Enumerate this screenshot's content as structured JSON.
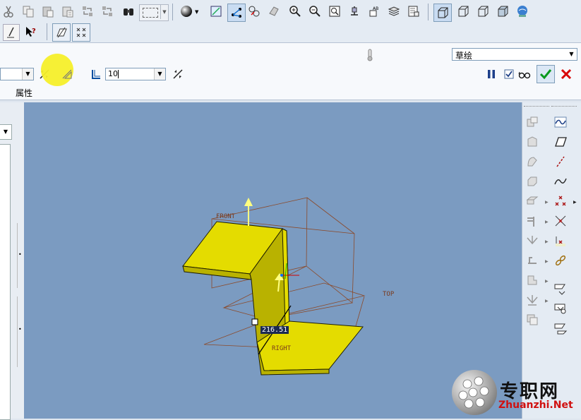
{
  "toolbar": {
    "row1_icons": [
      "cut-icon",
      "copy-icon",
      "paste-icon",
      "paste-special-icon",
      "regenerate-icon",
      "regenerate-manager-icon",
      "find-icon",
      "select-box-icon",
      "shading-icon",
      "repaint-icon",
      "sketch-orient-icon",
      "datum-display-icon",
      "zoom-in-icon",
      "zoom-out-icon",
      "refit-icon",
      "spin-center-icon",
      "named-views-icon",
      "layers-icon",
      "model-tree-icon",
      "wireframe-icon",
      "hidden-line-icon",
      "no-hidden-icon",
      "shaded-icon",
      "help-web-icon"
    ],
    "row2_icons": [
      "sketch-tool-icon",
      "context-help-icon",
      "plane-tool-icon",
      "axis-tool-icon"
    ]
  },
  "dashboard": {
    "thickness_value": "10",
    "tab_label": "属性",
    "mode_select": "草绘"
  },
  "viewport": {
    "datum_labels": [
      "FRONT",
      "TOP",
      "RIGHT"
    ],
    "dimension": "216.51",
    "background": "#7b9bc1",
    "sheet_color": "#e4dc00"
  },
  "watermark": {
    "cn_text": "专职网",
    "url_text": "Zhuanzhi.Net"
  },
  "side_tools": [
    "sketch-icon",
    "parallelogram-icon",
    "dashed-line-icon",
    "spline-icon",
    "points-icon",
    "cross-points-icon",
    "coordinate-icon",
    "chain-icon",
    "view-1-icon",
    "view-2-icon",
    "view-3-icon"
  ]
}
